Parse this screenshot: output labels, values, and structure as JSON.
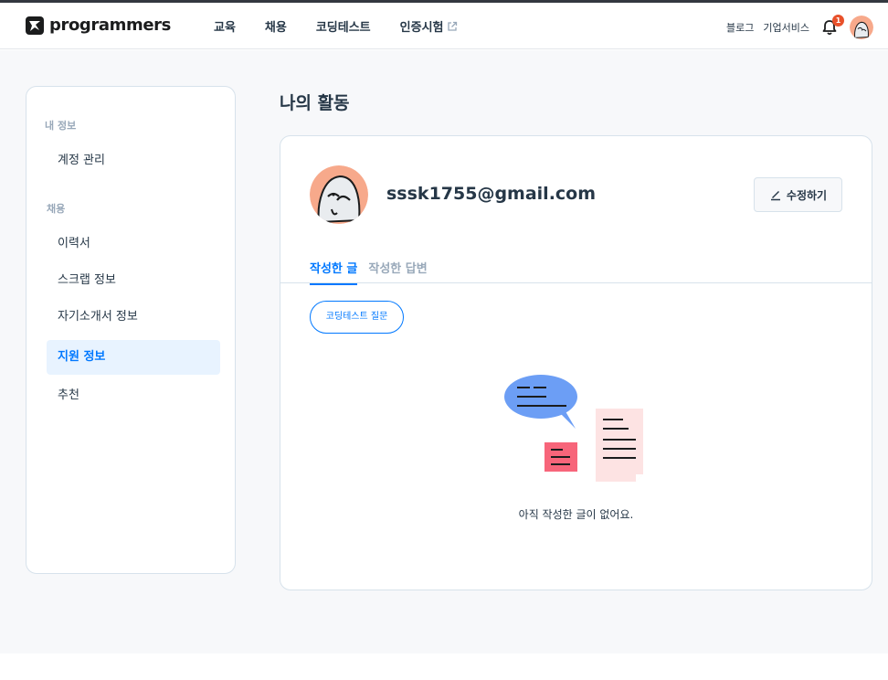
{
  "header": {
    "logo_text": "programmers",
    "nav": [
      "교육",
      "채용",
      "코딩테스트",
      "인증시험"
    ],
    "right_links": [
      "블로그",
      "기업서비스"
    ],
    "notification_count": "1"
  },
  "sidebar": {
    "sections": [
      {
        "title": "내 정보",
        "items": [
          "계정 관리"
        ]
      },
      {
        "title": "채용",
        "items": [
          "이력서",
          "스크랩 정보",
          "자기소개서 정보",
          "지원 정보",
          "추천"
        ]
      }
    ],
    "active_item": "지원 정보"
  },
  "main": {
    "title": "나의 활동",
    "email": "sssk1755@gmail.com",
    "edit_label": "수정하기",
    "tabs": [
      "작성한 글",
      "작성한 답변"
    ],
    "active_tab": "작성한 글",
    "filter_chip": "코딩테스트 질문",
    "empty_message": "아직 작성한 글이 없어요."
  },
  "colors": {
    "accent": "#0078ff",
    "badge": "#e8512b",
    "avatar_bg": "#f7a98b"
  }
}
